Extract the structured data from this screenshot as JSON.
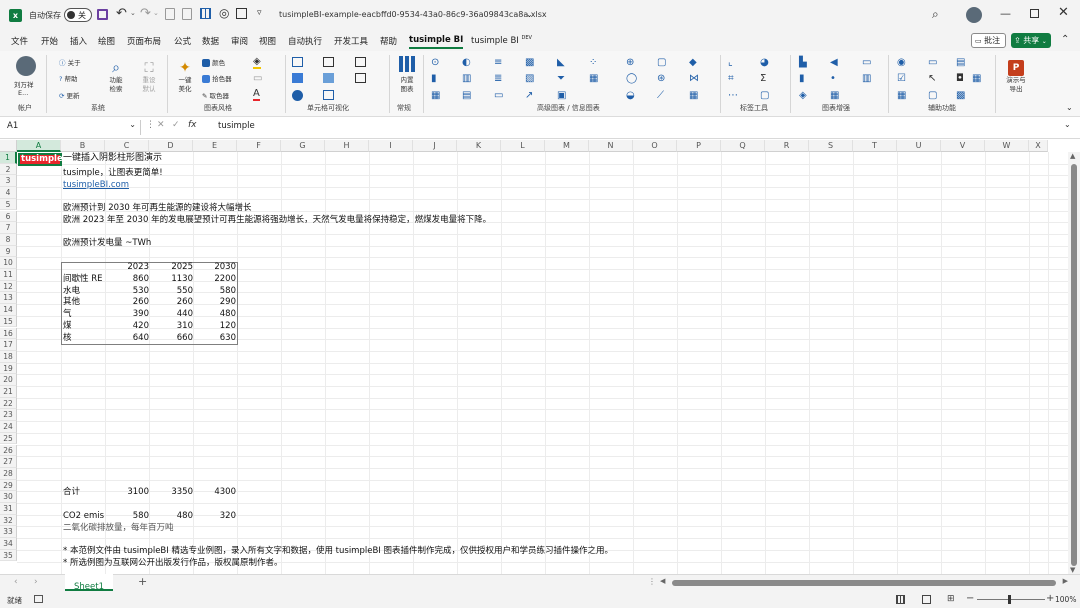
{
  "colors": {
    "accent": "#107c41",
    "tusimple_red": "#e8262b",
    "link": "#1f5ea8"
  },
  "titlebar": {
    "autosave_label": "自动保存",
    "autosave_toggle": "关",
    "filename": "tusimpleBI-example-eacbffd0-9534-43a0-86c9-36a09843ca8a.xlsx"
  },
  "menu": {
    "items": [
      "文件",
      "开始",
      "插入",
      "绘图",
      "页面布局",
      "公式",
      "数据",
      "审阅",
      "视图",
      "自动执行",
      "开发工具",
      "帮助",
      "tusimple BI",
      "tusimple BI"
    ],
    "dev_badge": "DEV",
    "comments_label": "批注",
    "share_label": "共享"
  },
  "ribbon": {
    "account_user": "刘万祥",
    "account_sub": "E...",
    "about": "关于",
    "help": "帮助",
    "update": "更新",
    "function_search": "功能\n检索",
    "reset_default": "重设\n默认",
    "one_click": "一键\n美化",
    "color": "颜色",
    "picker": "拾色器",
    "color2": "取色器",
    "builtin_chart": "内置\n图表",
    "present_export": "演示与\n导出",
    "groups": {
      "account": "帐户",
      "system": "系统",
      "chart_style": "图表风格",
      "cell_viz": "单元格可视化",
      "common": "常规",
      "advanced": "高级图表 / 信息图表",
      "label_tools": "标签工具",
      "chart_enhance": "图表增强",
      "aux": "辅助功能"
    }
  },
  "formula": {
    "namebox": "A1",
    "fx": "fx",
    "content": "tusimple"
  },
  "columns": [
    "A",
    "B",
    "C",
    "D",
    "E",
    "F",
    "G",
    "H",
    "I",
    "J",
    "K",
    "L",
    "M",
    "N",
    "O",
    "P",
    "Q",
    "R",
    "S",
    "T",
    "U",
    "V",
    "W",
    "X"
  ],
  "rows": [
    "1",
    "2",
    "3",
    "4",
    "5",
    "6",
    "7",
    "8",
    "9",
    "10",
    "11",
    "12",
    "13",
    "14",
    "15",
    "16",
    "17",
    "18",
    "19",
    "20",
    "21",
    "22",
    "23",
    "24",
    "25",
    "26",
    "27",
    "28",
    "29",
    "30",
    "31",
    "32",
    "33",
    "34",
    "35"
  ],
  "sheet": {
    "a1": "tusimple",
    "b1": "一键插入阴影柱形图演示",
    "b2": "tusimple，让图表更简单!",
    "b3": "tusimpleBI.com",
    "b5": "欧洲预计到 2030 年可再生能源的建设将大幅增长",
    "b6": "欧洲 2023 年至 2030 年的发电展望预计可再生能源将强劲增长，天然气发电量将保持稳定，燃煤发电量将下降。",
    "b8": "欧洲预计发电量 ~TWh",
    "table": {
      "years": [
        "2023",
        "2025",
        "2030"
      ],
      "rows": [
        {
          "name": "间歇性 RE",
          "v": [
            "860",
            "1130",
            "2200"
          ]
        },
        {
          "name": "水电",
          "v": [
            "530",
            "550",
            "580"
          ]
        },
        {
          "name": "其他",
          "v": [
            "260",
            "260",
            "290"
          ]
        },
        {
          "name": "气",
          "v": [
            "390",
            "440",
            "480"
          ]
        },
        {
          "name": "煤",
          "v": [
            "420",
            "310",
            "120"
          ]
        },
        {
          "name": "核",
          "v": [
            "640",
            "660",
            "630"
          ]
        }
      ]
    },
    "total_label": "合计",
    "totals": [
      "3100",
      "3350",
      "4300"
    ],
    "co2_label": "CO2 emis:",
    "co2": [
      "580",
      "480",
      "320"
    ],
    "co2_note": "二氧化碳排放量，每年百万吨",
    "note1": "* 本范例文件由 tusimpleBI 精选专业例图，录入所有文字和数据，使用 tusimpleBI 图表插件制作完成，仅供授权用户和学员练习插件操作之用。",
    "note2": "* 所选例图为互联网公开出版发行作品，版权属原制作者。"
  },
  "tabs": {
    "sheet1": "Sheet1"
  },
  "status": {
    "ready": "就绪",
    "zoom": "100%"
  }
}
